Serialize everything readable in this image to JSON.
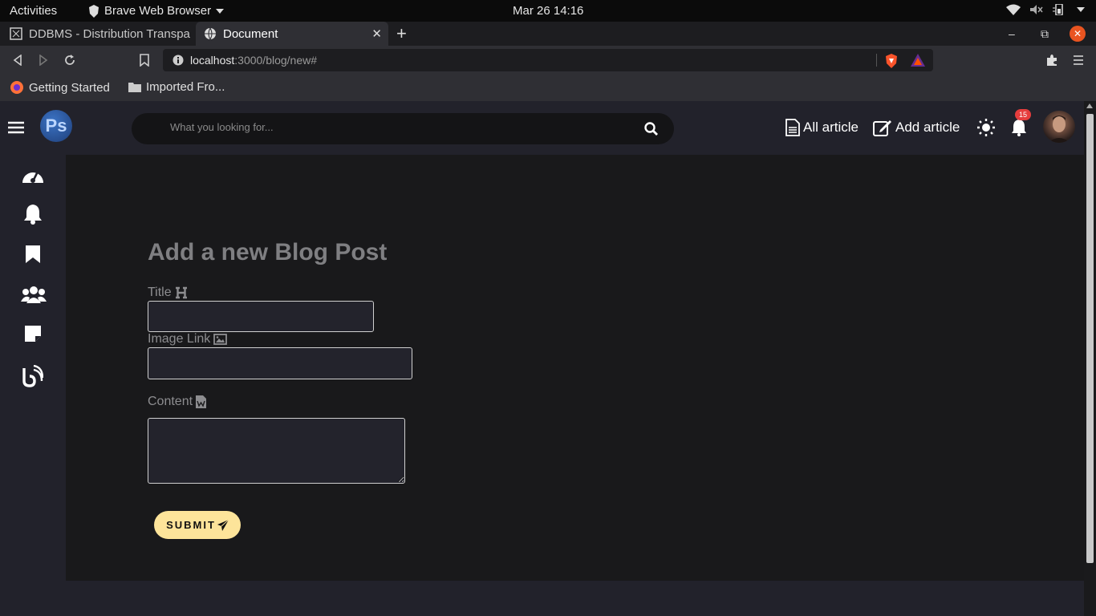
{
  "os": {
    "activities": "Activities",
    "app_name": "Brave Web Browser",
    "clock": "Mar 26  14:16"
  },
  "browser": {
    "tabs": [
      {
        "label": "DDBMS - Distribution Transpa",
        "active": false
      },
      {
        "label": "Document",
        "active": true
      }
    ],
    "url_host": "localhost",
    "url_path": ":3000/blog/new#",
    "bookmarks": [
      "Getting Started",
      "Imported Fro..."
    ]
  },
  "app": {
    "logo_text": "Ps",
    "search_placeholder": "What you looking for...",
    "nav": {
      "all_article": "All article",
      "add_article": "Add article"
    },
    "notification_count": "15",
    "sidebar_icons": [
      "dashboard-icon",
      "bell-icon",
      "bookmark-icon",
      "users-icon",
      "sticky-note-icon",
      "blog-icon"
    ],
    "form": {
      "heading": "Add a new Blog Post",
      "title_label": "Title",
      "title_value": "",
      "image_label": "Image Link",
      "image_value": "",
      "content_label": "Content",
      "content_value": "",
      "submit_label": "SUBMIT"
    }
  },
  "colors": {
    "accent": "#fde49a",
    "badge": "#e63d3d",
    "header_bg": "#22222b",
    "main_bg": "#19191b"
  }
}
